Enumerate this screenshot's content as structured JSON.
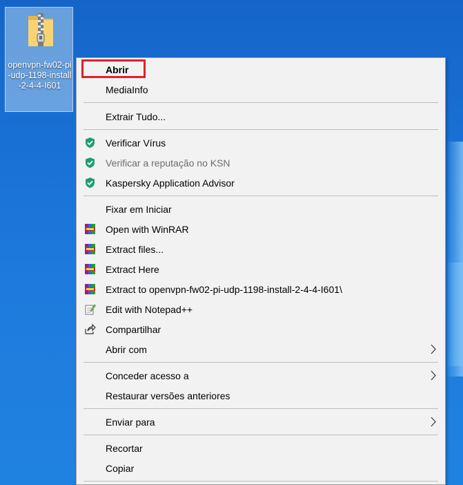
{
  "desktop": {
    "file_icon_label": "openvpn-fw02-pi-udp-1198-install-2-4-4-I601"
  },
  "context_menu": {
    "items": [
      {
        "label": "Abrir",
        "icon": "",
        "bold": true,
        "highlighted": true
      },
      {
        "label": "MediaInfo",
        "icon": ""
      },
      {
        "label": "Extrair Tudo...",
        "icon": ""
      },
      {
        "label": "Verificar Vírus",
        "icon": "kaspersky-shield-icon"
      },
      {
        "label": "Verificar a reputação no KSN",
        "icon": "kaspersky-shield-icon",
        "disabled": true
      },
      {
        "label": "Kaspersky Application Advisor",
        "icon": "kaspersky-shield-icon"
      },
      {
        "label": "Fixar em Iniciar",
        "icon": ""
      },
      {
        "label": "Open with WinRAR",
        "icon": "winrar-icon"
      },
      {
        "label": "Extract files...",
        "icon": "winrar-icon"
      },
      {
        "label": "Extract Here",
        "icon": "winrar-icon"
      },
      {
        "label": "Extract to openvpn-fw02-pi-udp-1198-install-2-4-4-I601\\",
        "icon": "winrar-icon"
      },
      {
        "label": "Edit with Notepad++",
        "icon": "notepad-plus-plus-icon"
      },
      {
        "label": "Compartilhar",
        "icon": "share-icon"
      },
      {
        "label": "Abrir com",
        "icon": "",
        "submenu": true
      },
      {
        "label": "Conceder acesso a",
        "icon": "",
        "submenu": true
      },
      {
        "label": "Restaurar versões anteriores",
        "icon": ""
      },
      {
        "label": "Enviar para",
        "icon": "",
        "submenu": true
      },
      {
        "label": "Recortar",
        "icon": ""
      },
      {
        "label": "Copiar",
        "icon": ""
      }
    ]
  },
  "colors": {
    "desktop_blue": "#1a72d6",
    "menu_background": "#f2f2f2",
    "highlight_box": "#e0202a",
    "kaspersky_green": "#1e9e74"
  }
}
